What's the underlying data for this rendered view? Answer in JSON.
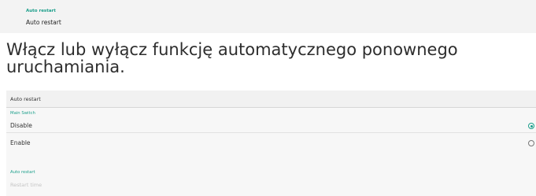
{
  "top_panel": {
    "section_label": "Auto restart",
    "item_label": "Auto restart"
  },
  "description": "Włącz lub wyłącz funkcję automatycznego ponownego uruchamiania.",
  "dialog": {
    "title": "Auto restart",
    "main_switch": {
      "group_label": "Main Switch",
      "options": [
        {
          "label": "Disable",
          "selected": true
        },
        {
          "label": "Enable",
          "selected": false
        }
      ]
    },
    "restart_section": {
      "group_label": "Auto restart",
      "restart_time_label": "Restart time"
    }
  },
  "colors": {
    "accent": "#1a9e8a",
    "panel_bg": "#f3f3f3",
    "dialog_bg": "#f7f7f7"
  }
}
